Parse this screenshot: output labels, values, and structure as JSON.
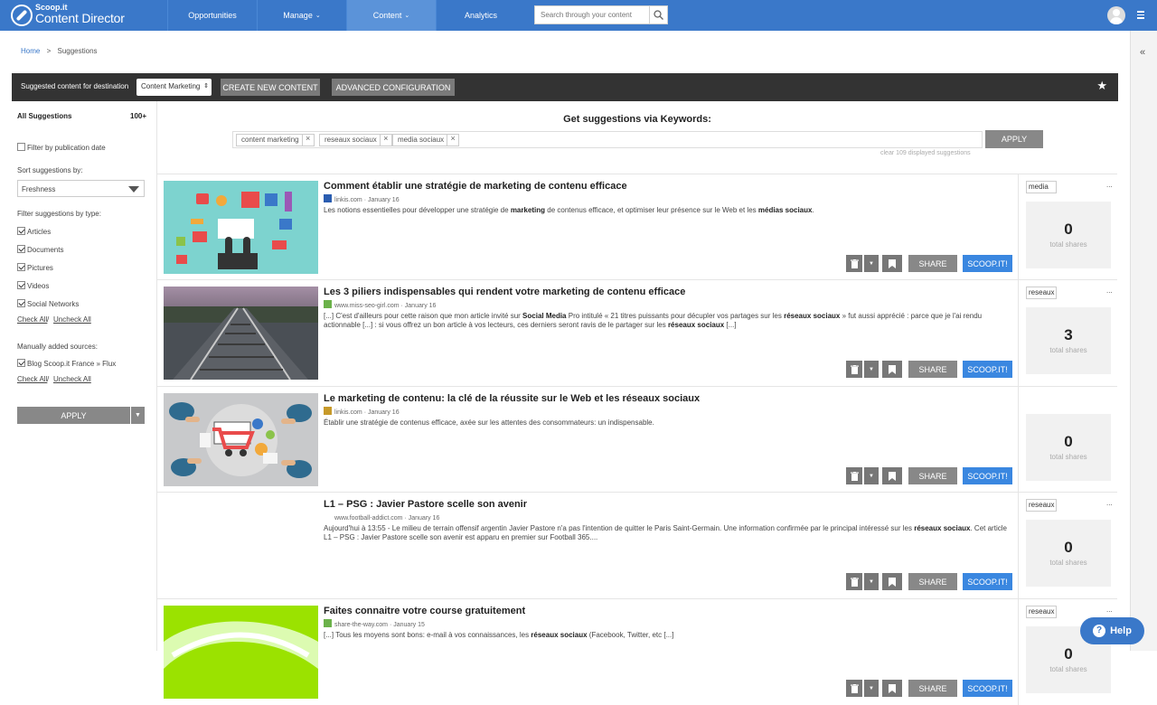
{
  "app": {
    "logo_small": "Scoop.it",
    "logo_name": "Content Director"
  },
  "nav": [
    {
      "label": "Opportunities",
      "caret": false,
      "active": false
    },
    {
      "label": "Manage",
      "caret": true,
      "active": false
    },
    {
      "label": "Content",
      "caret": true,
      "active": true
    },
    {
      "label": "Analytics",
      "caret": false,
      "active": false
    }
  ],
  "search": {
    "placeholder": "Search through your content"
  },
  "breadcrumb": {
    "home": "Home",
    "sep": ">",
    "current": "Suggestions"
  },
  "toolbar": {
    "label": "Suggested content for destination",
    "destination": "Content Marketing",
    "create_label": "CREATE NEW CONTENT",
    "advanced_label": "ADVANCED CONFIGURATION"
  },
  "sidebar": {
    "all_label": "All Suggestions",
    "all_count": "100+",
    "filter_date": "Filter by publication date",
    "sort_label": "Sort suggestions by:",
    "sort_value": "Freshness",
    "type_label": "Filter suggestions by type:",
    "types": [
      "Articles",
      "Documents",
      "Pictures",
      "Videos",
      "Social Networks"
    ],
    "check_all": "Check All",
    "slash": "/",
    "uncheck_all": "Uncheck All",
    "manual_label": "Manually added sources:",
    "sources": [
      "Blog Scoop.it France » Flux"
    ],
    "apply_label": "APPLY"
  },
  "keywords": {
    "title": "Get suggestions via Keywords:",
    "tags": [
      "content marketing",
      "reseaux sociaux",
      "media sociaux"
    ],
    "apply_label": "APPLY",
    "clear_text": "clear 109 displayed suggestions"
  },
  "actions": {
    "share": "SHARE",
    "scoop": "SCOOP.IT!"
  },
  "stats_label": "total shares",
  "cards": [
    {
      "title": "Comment établir une stratégie de marketing de contenu efficace",
      "source": "linkis.com",
      "date": "· January 16",
      "favicon": "#2a5db0",
      "desc": "Les notions essentielles pour développer une stratégie de <b>marketing</b> de contenus efficace, et optimiser leur présence sur le Web et les <b>médias sociaux</b>.",
      "topic": "media",
      "shares": "0",
      "image": "infographic"
    },
    {
      "title": "Les 3 piliers indispensables qui rendent votre marketing de contenu efficace",
      "source": "www.miss-seo-girl.com",
      "date": "· January 16",
      "favicon": "#6bb24a",
      "desc": "[...] C'est d'ailleurs pour cette raison que mon article invité sur <b>Social Media</b> Pro intitulé « 21 titres puissants pour décupler vos partages sur les <b>réseaux sociaux</b> » fut aussi apprécié : parce que je l'ai rendu actionnable [...] : si vous offrez un bon article à vos lecteurs, ces derniers seront ravis de le partager sur les <b>réseaux sociaux</b> [...]",
      "topic": "reseaux",
      "shares": "3",
      "image": "rails"
    },
    {
      "title": "Le marketing de contenu: la clé de la réussite sur le Web et les réseaux sociaux",
      "source": "linkis.com",
      "date": "· January 16",
      "favicon": "#c79a2a",
      "desc": "Établir une stratégie de contenus efficace, axée sur les attentes des consommateurs: un indispensable.",
      "topic": "",
      "shares": "0",
      "image": "table"
    },
    {
      "title": "L1 – PSG : Javier Pastore scelle son avenir",
      "source": "www.football-addict.com",
      "date": "· January 16",
      "favicon": "",
      "desc": "Aujourd'hui à 13:55 - Le milieu de terrain offensif argentin Javier Pastore n'a pas l'intention de quitter le Paris Saint-Germain. Une information confirmée par le principal intéressé sur les <b>réseaux sociaux</b>. Cet article L1 – PSG : Javier Pastore scelle son avenir est apparu en premier sur Football 365....",
      "topic": "reseaux",
      "shares": "0",
      "image": "none"
    },
    {
      "title": "Faites connaitre votre course gratuitement",
      "source": "share-the-way.com",
      "date": "· January 15",
      "favicon": "#6bb24a",
      "desc": "[...] Tous les moyens sont bons: e-mail à vos connaissances, les <b>réseaux sociaux</b> (Facebook, Twitter, etc [...]",
      "topic": "reseaux",
      "shares": "0",
      "image": "green"
    }
  ],
  "help_label": "Help"
}
